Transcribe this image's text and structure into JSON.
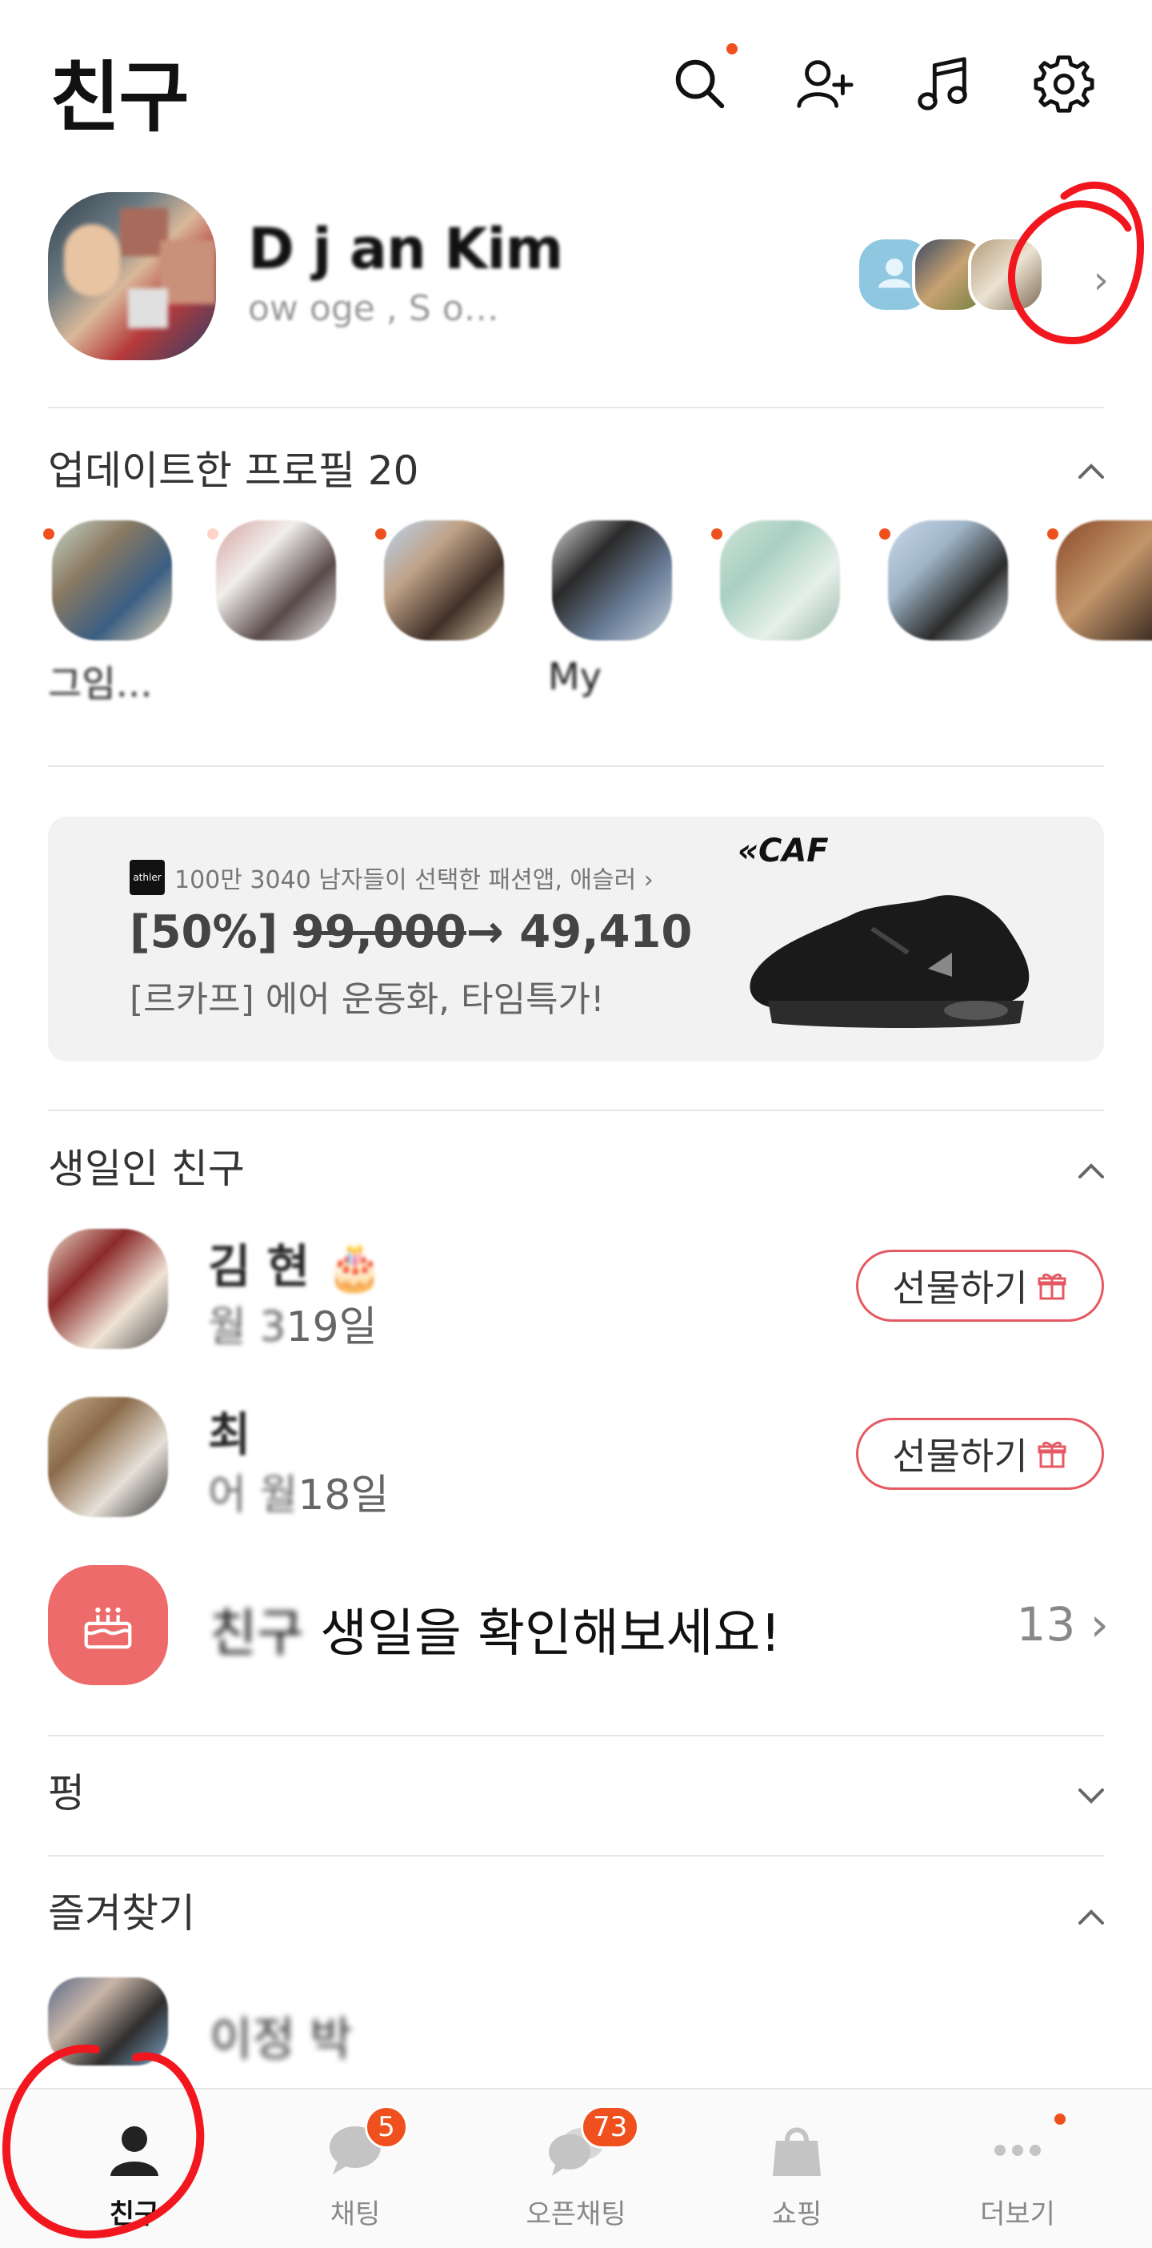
{
  "header": {
    "title": "친구",
    "icons": [
      "search-icon",
      "add-friend-icon",
      "music-icon",
      "settings-icon"
    ]
  },
  "my_profile": {
    "name": "D  j  an Kim",
    "status": "  ow  oge  ,  S     o…"
  },
  "updated_profiles": {
    "title": "업데이트한 프로필 20",
    "items": [
      {
        "name": "그임…"
      },
      {
        "name": "  "
      },
      {
        "name": "  "
      },
      {
        "name": "My  "
      },
      {
        "name": "  "
      },
      {
        "name": "  "
      },
      {
        "name": "  "
      }
    ]
  },
  "ad": {
    "logo_text": "athler",
    "sponsor": "100만 3040 남자들이 선택한 패션앱, 애슬러 ›",
    "discount": "[50%]",
    "old_price": "99,000",
    "arrow_price": "→ 49,410",
    "subtitle": "[르카프] 에어 운동화, 타임특가!",
    "brand": "«CAF"
  },
  "birthday": {
    "title": "생일인 친구",
    "friends": [
      {
        "name": "김  현",
        "date_prefix": "  월 3",
        "date_suffix": "19일",
        "gift_label": "선물하기"
      },
      {
        "name": "  최  ",
        "date_prefix": "어  월",
        "date_suffix": "18일",
        "gift_label": "선물하기"
      }
    ],
    "more_prefix": "친구",
    "more_text": "생일을 확인해보세요!",
    "more_count": "13"
  },
  "sections": {
    "pung": "펑",
    "favorites": "즐겨찾기"
  },
  "favorites": [
    {
      "name": "이정   박  "
    }
  ],
  "bottom_nav": [
    {
      "label": "친구",
      "badge": ""
    },
    {
      "label": "채팅",
      "badge": "5"
    },
    {
      "label": "오픈채팅",
      "badge": "73"
    },
    {
      "label": "쇼핑",
      "badge": ""
    },
    {
      "label": "더보기",
      "badge": ""
    }
  ],
  "colors": {
    "accent": "#f0501e",
    "gift_border": "#e55a62",
    "cake_bg": "#ee6b6b"
  }
}
